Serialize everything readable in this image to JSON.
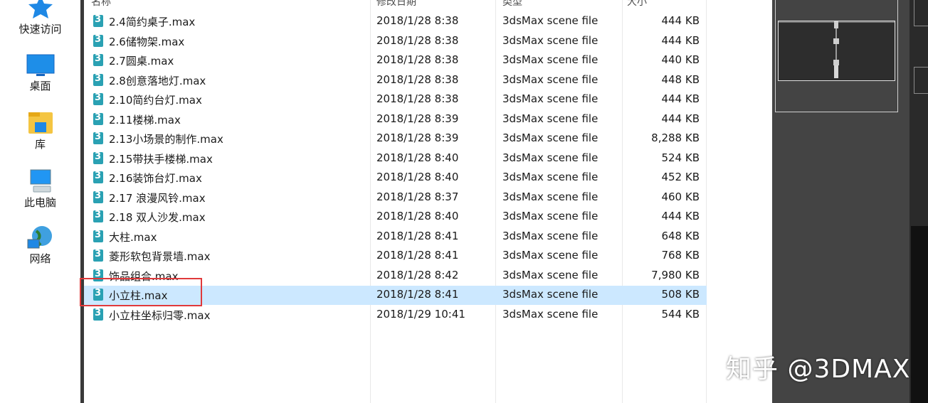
{
  "nav": {
    "items": [
      {
        "label": "快速访问",
        "icon": "star-icon"
      },
      {
        "label": "桌面",
        "icon": "desktop-icon"
      },
      {
        "label": "库",
        "icon": "library-icon"
      },
      {
        "label": "此电脑",
        "icon": "computer-icon"
      },
      {
        "label": "网络",
        "icon": "network-icon"
      }
    ]
  },
  "columns": {
    "name": "名称",
    "date": "修改日期",
    "type": "类型",
    "size": "大小"
  },
  "files": [
    {
      "name": "2.4简约桌子.max",
      "date": "2018/1/28 8:38",
      "type": "3dsMax scene file",
      "size": "444 KB"
    },
    {
      "name": "2.6储物架.max",
      "date": "2018/1/28 8:38",
      "type": "3dsMax scene file",
      "size": "444 KB"
    },
    {
      "name": "2.7圆桌.max",
      "date": "2018/1/28 8:38",
      "type": "3dsMax scene file",
      "size": "440 KB"
    },
    {
      "name": "2.8创意落地灯.max",
      "date": "2018/1/28 8:38",
      "type": "3dsMax scene file",
      "size": "448 KB"
    },
    {
      "name": "2.10简约台灯.max",
      "date": "2018/1/28 8:38",
      "type": "3dsMax scene file",
      "size": "444 KB"
    },
    {
      "name": "2.11楼梯.max",
      "date": "2018/1/28 8:39",
      "type": "3dsMax scene file",
      "size": "444 KB"
    },
    {
      "name": "2.13小场景的制作.max",
      "date": "2018/1/28 8:39",
      "type": "3dsMax scene file",
      "size": "8,288 KB"
    },
    {
      "name": "2.15带扶手楼梯.max",
      "date": "2018/1/28 8:40",
      "type": "3dsMax scene file",
      "size": "524 KB"
    },
    {
      "name": "2.16装饰台灯.max",
      "date": "2018/1/28 8:40",
      "type": "3dsMax scene file",
      "size": "452 KB"
    },
    {
      "name": "2.17 浪漫风铃.max",
      "date": "2018/1/28 8:37",
      "type": "3dsMax scene file",
      "size": "460 KB"
    },
    {
      "name": "2.18 双人沙发.max",
      "date": "2018/1/28 8:40",
      "type": "3dsMax scene file",
      "size": "444 KB"
    },
    {
      "name": "大柱.max",
      "date": "2018/1/28 8:41",
      "type": "3dsMax scene file",
      "size": "648 KB"
    },
    {
      "name": "菱形软包背景墙.max",
      "date": "2018/1/28 8:41",
      "type": "3dsMax scene file",
      "size": "768 KB"
    },
    {
      "name": "饰品组合.max",
      "date": "2018/1/28 8:42",
      "type": "3dsMax scene file",
      "size": "7,980 KB"
    },
    {
      "name": "小立柱.max",
      "date": "2018/1/28 8:41",
      "type": "3dsMax scene file",
      "size": "508 KB",
      "selected": true
    },
    {
      "name": "小立柱坐标归零.max",
      "date": "2018/1/29 10:41",
      "type": "3dsMax scene file",
      "size": "544 KB"
    }
  ],
  "watermark": "知乎 @3DMAX",
  "colors": {
    "selection": "#cce8ff",
    "highlight_box": "#e0393b",
    "file_icon": "#2aa1b3"
  }
}
